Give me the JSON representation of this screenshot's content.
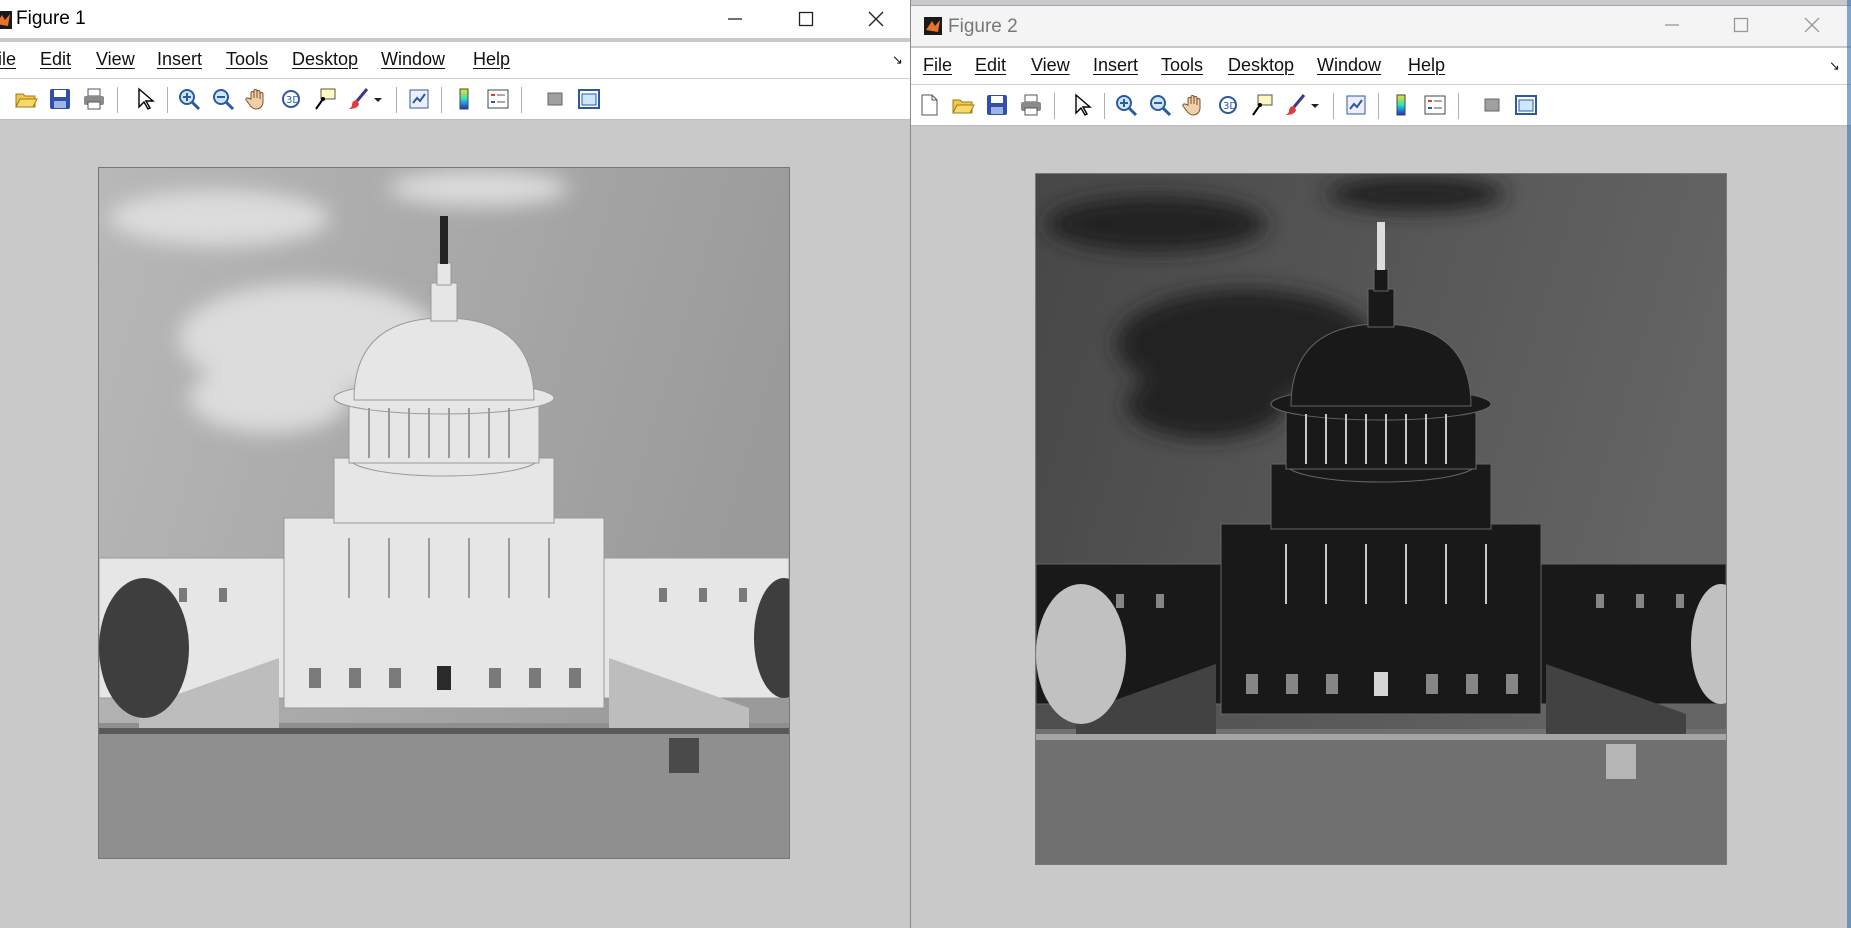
{
  "figure1": {
    "title": "Figure 1",
    "menu": [
      "ile",
      "Edit",
      "View",
      "Insert",
      "Tools",
      "Desktop",
      "Window",
      "Help"
    ],
    "dock_glyph": "↘",
    "toolbar_icons": [
      "open-folder-icon",
      "save-icon",
      "print-icon",
      "pointer-icon",
      "zoom-in-icon",
      "zoom-out-icon",
      "pan-hand-icon",
      "rotate-3d-icon",
      "data-cursor-icon",
      "brush-icon",
      "brush-menu-icon",
      "link-plot-icon",
      "colorbar-icon",
      "legend-icon",
      "hide-tools-icon",
      "show-tools-icon"
    ],
    "image": "grayscale capitol"
  },
  "figure2": {
    "title": "Figure 2",
    "menu": [
      "File",
      "Edit",
      "View",
      "Insert",
      "Tools",
      "Desktop",
      "Window",
      "Help"
    ],
    "dock_glyph": "↘",
    "toolbar_icons": [
      "new-figure-icon",
      "open-folder-icon",
      "save-icon",
      "print-icon",
      "pointer-icon",
      "zoom-in-icon",
      "zoom-out-icon",
      "pan-hand-icon",
      "rotate-3d-icon",
      "data-cursor-icon",
      "brush-icon",
      "brush-menu-icon",
      "link-plot-icon",
      "colorbar-icon",
      "legend-icon",
      "hide-tools-icon",
      "show-tools-icon"
    ],
    "image": "negative capitol"
  },
  "colors": {
    "figure_bg": "#c9c9c9",
    "titlebar": "#ffffff",
    "matlab_orange": "#e8732a"
  }
}
